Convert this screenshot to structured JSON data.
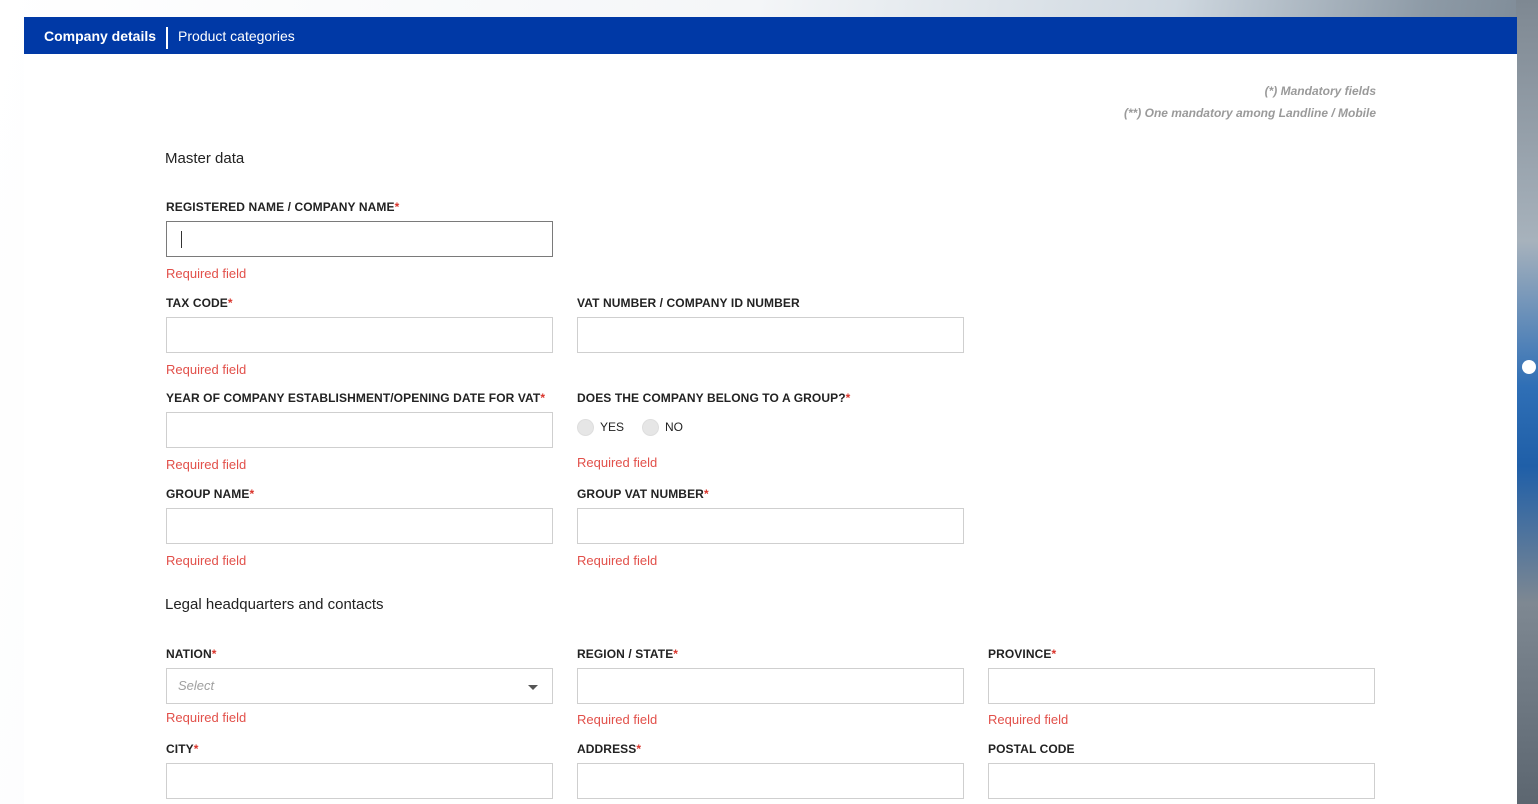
{
  "tabs": [
    {
      "label": "Company details",
      "active": true
    },
    {
      "label": "Product categories",
      "active": false
    }
  ],
  "notes": {
    "mandatory": "(*) Mandatory fields",
    "one_mandatory": "(**) One mandatory among Landline / Mobile"
  },
  "sections": {
    "master_data": "Master data",
    "legal_hq": "Legal headquarters and contacts"
  },
  "required_mark": "*",
  "error_text": "Required field",
  "fields": {
    "registered_name": {
      "label": "REGISTERED NAME / COMPANY NAME",
      "value": ""
    },
    "tax_code": {
      "label": "TAX CODE",
      "value": ""
    },
    "vat_number": {
      "label": "VAT NUMBER / COMPANY ID NUMBER",
      "value": ""
    },
    "establishment_year": {
      "label": "YEAR OF COMPANY ESTABLISHMENT/OPENING DATE FOR VAT",
      "value": ""
    },
    "belongs_group": {
      "label": "DOES THE COMPANY BELONG TO A GROUP?",
      "options": [
        "YES",
        "NO"
      ]
    },
    "group_name": {
      "label": "GROUP NAME",
      "value": ""
    },
    "group_vat": {
      "label": "GROUP VAT NUMBER",
      "value": ""
    },
    "nation": {
      "label": "NATION",
      "placeholder": "Select"
    },
    "region": {
      "label": "REGION / STATE",
      "value": ""
    },
    "province": {
      "label": "PROVINCE",
      "value": ""
    },
    "city": {
      "label": "CITY",
      "value": ""
    },
    "address": {
      "label": "ADDRESS",
      "value": ""
    },
    "postal_code": {
      "label": "POSTAL CODE",
      "value": ""
    }
  },
  "colors": {
    "brand": "#0039a6",
    "error": "#e2504a",
    "required": "#d9342b"
  }
}
